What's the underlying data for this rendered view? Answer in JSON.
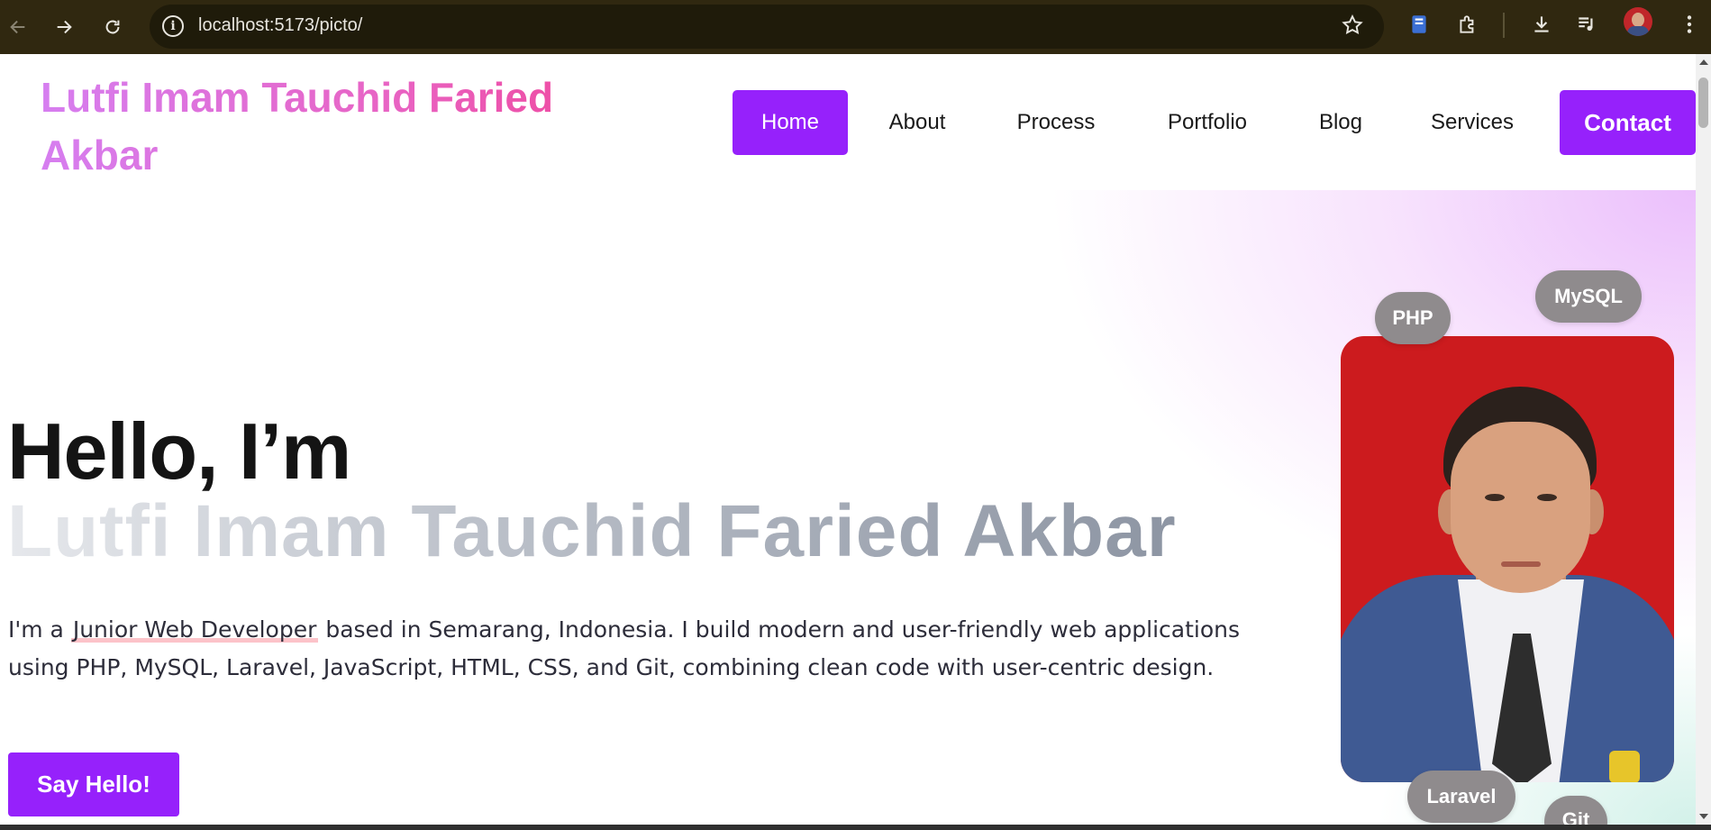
{
  "browser": {
    "url": "localhost:5173/picto/"
  },
  "site": {
    "brand_line1": "Lutfi Imam Tauchid Faried",
    "brand_line2": "Akbar",
    "nav": {
      "home": "Home",
      "about": "About",
      "process": "Process",
      "portfolio": "Portfolio",
      "blog": "Blog",
      "services": "Services",
      "contact": "Contact"
    },
    "active_nav": "Home",
    "accent_color": "#9621fb"
  },
  "hero": {
    "greeting": "Hello, I’m",
    "name": "Lutfi Imam Tauchid Faried Akbar",
    "intro_prefix": "I'm a",
    "intro_highlight": "Junior Web Developer",
    "intro_rest": "based in Semarang, Indonesia. I build modern and user-friendly web applications using PHP, MySQL, Laravel, JavaScript, HTML, CSS, and Git, combining clean code with user-centric design.",
    "cta": "Say Hello!",
    "tags": {
      "php": "PHP",
      "mysql": "MySQL",
      "laravel": "Laravel",
      "git": "Git"
    }
  }
}
